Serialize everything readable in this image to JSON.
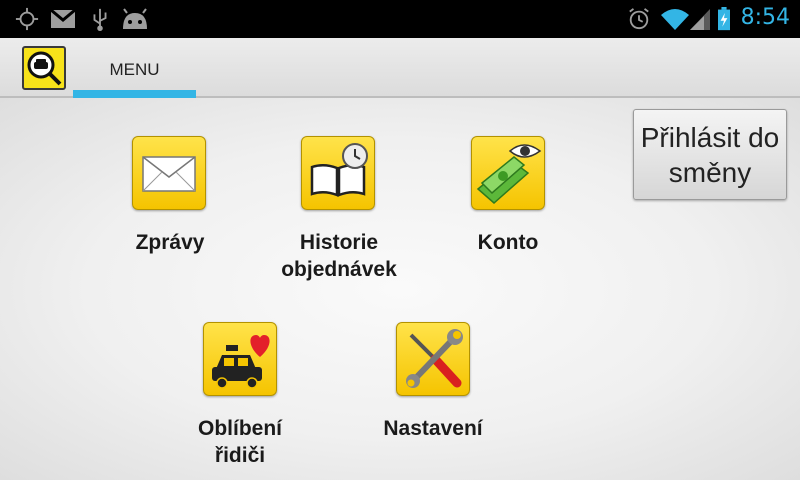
{
  "status_bar": {
    "time": "8:54",
    "icons": [
      "gps-icon",
      "gmail-icon",
      "usb-icon",
      "android-debug-icon",
      "alarm-icon",
      "wifi-icon",
      "signal-icon",
      "battery-charging-icon"
    ],
    "accent_color": "#33b5e5"
  },
  "action_bar": {
    "tab_label": "MENU",
    "indicator_color": "#33b5e5",
    "logo_color": "#f7e21a"
  },
  "login_button": {
    "label": "Přihlásit do směny"
  },
  "menu": {
    "items": [
      {
        "label": "Zprávy",
        "icon": "envelope-icon"
      },
      {
        "label": "Historie objednávek",
        "icon": "book-clock-icon"
      },
      {
        "label": "Konto",
        "icon": "money-eye-icon"
      },
      {
        "label": "Oblíbení řidiči",
        "icon": "taxi-heart-icon"
      },
      {
        "label": "Nastavení",
        "icon": "tools-icon"
      }
    ],
    "tile_color": "#f7d21a"
  }
}
